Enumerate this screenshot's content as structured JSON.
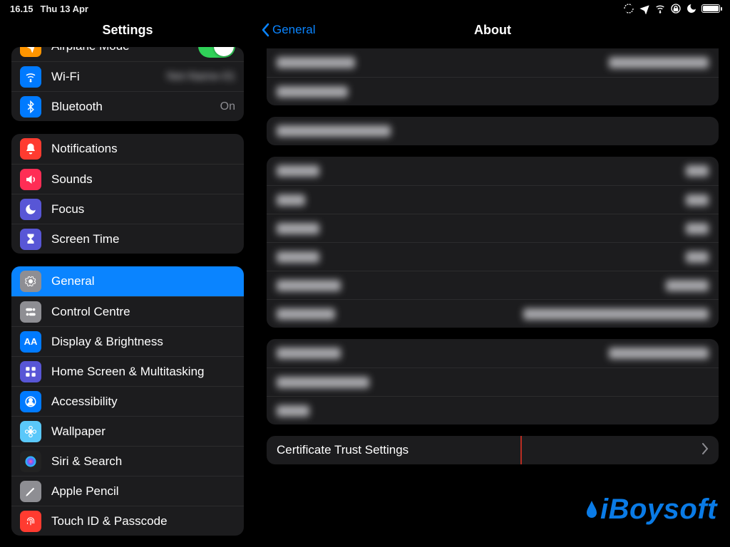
{
  "status": {
    "time": "16.15",
    "date": "Thu 13 Apr"
  },
  "sidebar": {
    "title": "Settings",
    "groups": [
      {
        "first": true,
        "items": [
          {
            "name": "airplane-mode",
            "label": "Airplane Mode",
            "icon": "airplane",
            "color": "c-orange",
            "toggle": true,
            "toggleOn": true,
            "clipped": true
          },
          {
            "name": "wifi",
            "label": "Wi-Fi",
            "icon": "wifi",
            "color": "c-blue",
            "valueBlur": true
          },
          {
            "name": "bluetooth",
            "label": "Bluetooth",
            "icon": "bluetooth",
            "color": "c-blue",
            "value": "On"
          }
        ]
      },
      {
        "items": [
          {
            "name": "notifications",
            "label": "Notifications",
            "icon": "bell",
            "color": "c-red"
          },
          {
            "name": "sounds",
            "label": "Sounds",
            "icon": "speaker",
            "color": "c-pink"
          },
          {
            "name": "focus",
            "label": "Focus",
            "icon": "moon",
            "color": "c-indigo"
          },
          {
            "name": "screen-time",
            "label": "Screen Time",
            "icon": "hourglass",
            "color": "c-indigo"
          }
        ]
      },
      {
        "items": [
          {
            "name": "general",
            "label": "General",
            "icon": "gear",
            "color": "c-gray",
            "selected": true
          },
          {
            "name": "control-centre",
            "label": "Control Centre",
            "icon": "switches",
            "color": "c-gray"
          },
          {
            "name": "display",
            "label": "Display & Brightness",
            "icon": "AA",
            "color": "c-blue"
          },
          {
            "name": "home-screen",
            "label": "Home Screen & Multitasking",
            "icon": "grid",
            "color": "c-indigo"
          },
          {
            "name": "accessibility",
            "label": "Accessibility",
            "icon": "person",
            "color": "c-blue"
          },
          {
            "name": "wallpaper",
            "label": "Wallpaper",
            "icon": "flower",
            "color": "c-teal"
          },
          {
            "name": "siri",
            "label": "Siri & Search",
            "icon": "siri",
            "color": "c-black"
          },
          {
            "name": "apple-pencil",
            "label": "Apple Pencil",
            "icon": "pencil",
            "color": "c-gray"
          },
          {
            "name": "touch-id",
            "label": "Touch ID & Passcode",
            "icon": "fingerprint",
            "color": "c-red"
          }
        ]
      }
    ]
  },
  "detail": {
    "back": "General",
    "title": "About",
    "groups": [
      {
        "first": true,
        "rows": [
          {
            "lw": 110,
            "rw": 140
          },
          {
            "lw": 100,
            "rw": 0
          }
        ]
      },
      {
        "rows": [
          {
            "lw": 160,
            "rw": 0
          }
        ]
      },
      {
        "rows": [
          {
            "lw": 60,
            "rw": 32
          },
          {
            "lw": 40,
            "rw": 32
          },
          {
            "lw": 60,
            "rw": 32
          },
          {
            "lw": 60,
            "rw": 32
          },
          {
            "lw": 90,
            "rw": 60
          },
          {
            "lw": 82,
            "rw": 260
          }
        ]
      },
      {
        "rows": [
          {
            "lw": 90,
            "rw": 140
          },
          {
            "lw": 130,
            "rw": 0
          },
          {
            "lw": 46,
            "rw": 0
          }
        ]
      },
      {
        "cert": true,
        "label": "Certificate Trust Settings"
      }
    ]
  },
  "watermark": "iBoysoft"
}
